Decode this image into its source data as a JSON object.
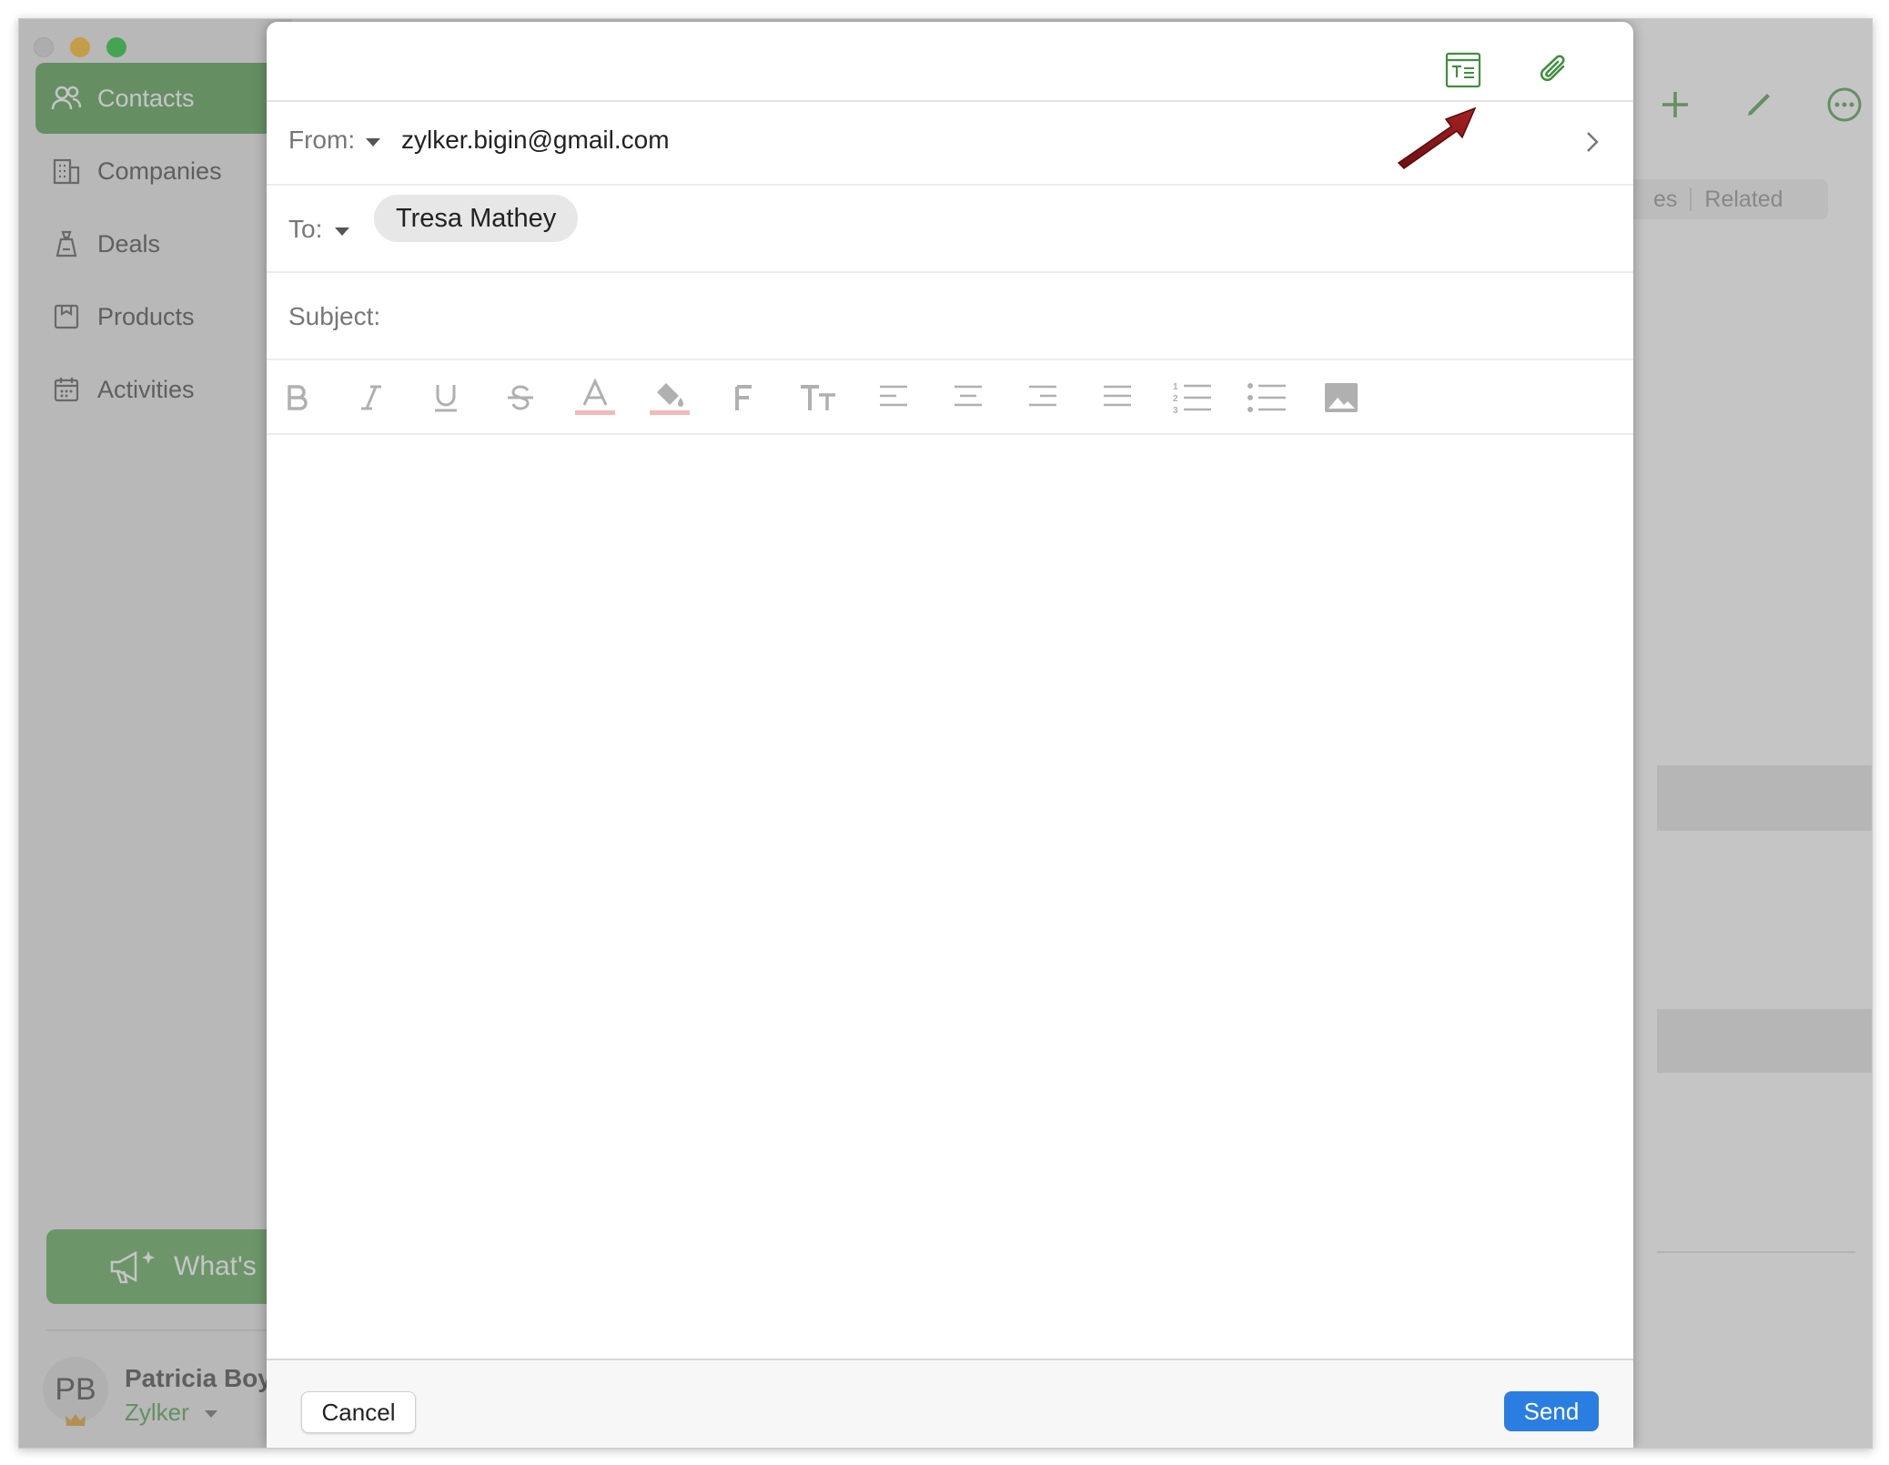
{
  "sidebar": {
    "items": [
      {
        "label": "Contacts",
        "icon": "contacts-icon",
        "active": true
      },
      {
        "label": "Companies",
        "icon": "building-icon",
        "active": false
      },
      {
        "label": "Deals",
        "icon": "deals-icon",
        "active": false
      },
      {
        "label": "Products",
        "icon": "box-icon",
        "active": false
      },
      {
        "label": "Activities",
        "icon": "calendar-icon",
        "active": false
      }
    ],
    "whats_new_label": "What's",
    "user": {
      "initials": "PB",
      "name": "Patricia Boy",
      "org": "Zylker"
    }
  },
  "main": {
    "tabs": {
      "partial": "es",
      "related": "Related"
    },
    "avatar_initials": "PB"
  },
  "compose": {
    "from_label": "From:",
    "from_value": "zylker.bigin@gmail.com",
    "to_label": "To:",
    "recipient": "Tresa Mathey",
    "subject_label": "Subject:",
    "subject_value": "",
    "toolbar": [
      "bold",
      "italic",
      "underline",
      "strikethrough",
      "font-color",
      "background-color",
      "font-family",
      "font-size",
      "align-left",
      "align-center",
      "align-right",
      "justify",
      "numbered-list",
      "bulleted-list",
      "insert-image"
    ],
    "cancel_label": "Cancel",
    "send_label": "Send"
  },
  "colors": {
    "accent_green": "#5fa55d",
    "send_blue": "#2a7de1",
    "annotation_arrow": "#8b1a1a"
  }
}
